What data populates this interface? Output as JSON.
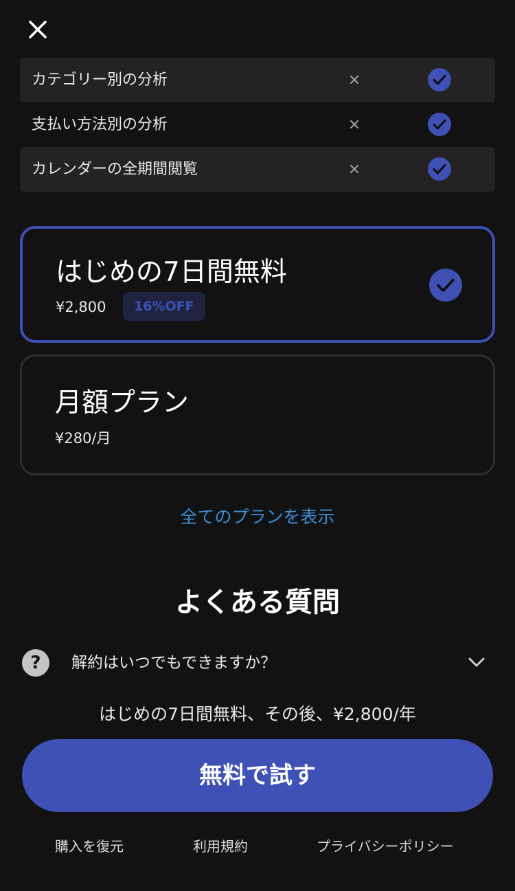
{
  "close_icon": "close-icon",
  "features": [
    {
      "label": "カテゴリー別の分析",
      "free_icon": "x-icon",
      "premium_icon": "check-icon"
    },
    {
      "label": "支払い方法別の分析",
      "free_icon": "x-icon",
      "premium_icon": "check-icon"
    },
    {
      "label": "カレンダーの全期間閲覧",
      "free_icon": "x-icon",
      "premium_icon": "check-icon"
    }
  ],
  "plans": [
    {
      "title": "はじめの7日間無料",
      "price": "¥2,800",
      "badge": "16%OFF",
      "selected": true
    },
    {
      "title": "月額プラン",
      "price": "¥280/月",
      "selected": false
    }
  ],
  "show_all_plans": "全てのプランを表示",
  "faq": {
    "heading": "よくある質問",
    "question_icon": "?",
    "question": "解約はいつでもできますか？",
    "answer": "はじめの7日間無料、その後、¥2,800/年"
  },
  "cta_label": "無料で試す",
  "footer": {
    "restore": "購入を復元",
    "terms": "利用規約",
    "privacy": "プライバシーポリシー"
  },
  "colors": {
    "background": "#121212",
    "accent": "#3f51b5",
    "link": "#3b8ed8",
    "row_shade": "#232323"
  }
}
